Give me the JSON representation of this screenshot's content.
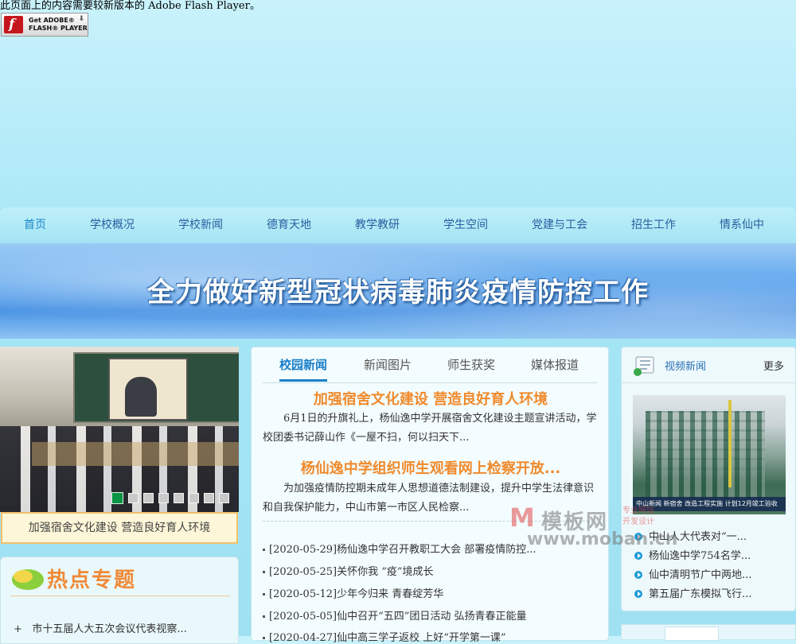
{
  "flash": {
    "notice": "此页面上的内容需要较新版本的 Adobe Flash Player。",
    "badge_line1": "Get ADOBE®",
    "badge_line2": "FLASH® PLAYER"
  },
  "nav": {
    "items": [
      "首页",
      "学校概况",
      "学校新闻",
      "德育天地",
      "教学教研",
      "学生空间",
      "党建与工会",
      "招生工作",
      "情系仙中"
    ],
    "active_index": 0
  },
  "banner": {
    "title": "全力做好新型冠状病毒肺炎疫情防控工作"
  },
  "slider": {
    "caption": "加强宿舍文化建设 营造良好育人环境",
    "dot_count": 8,
    "active_dot": 0
  },
  "hot_topics": {
    "title": "热点专题",
    "items": [
      {
        "prefix": "+",
        "text": "市十五届人大五次会议代表视察..."
      }
    ]
  },
  "news": {
    "tabs": [
      "校园新闻",
      "新闻图片",
      "师生获奖",
      "媒体报道"
    ],
    "active_tab": 0,
    "features": [
      {
        "title": "加强宿舍文化建设 营造良好育人环境",
        "summary": "6月1日的升旗礼上，杨仙逸中学开展宿舍文化建设主题宣讲活动，学校团委书记薛山作《一屋不扫，何以扫天下..."
      },
      {
        "title": "杨仙逸中学组织师生观看网上检察开放...",
        "summary": "为加强疫情防控期未成年人思想道德法制建设，提升中学生法律意识和自我保护能力，中山市第一市区人民检察..."
      }
    ],
    "list": [
      "[2020-05-29]杨仙逸中学召开教职工大会 部署疫情防控...",
      "[2020-05-25]关怀你我 “疫”境成长",
      "[2020-05-12]少年今归来 青春绽芳华",
      "[2020-05-05]仙中召开“五四”团日活动 弘扬青春正能量",
      "[2020-04-27]仙中高三学子返校 上好“开学第一课”"
    ]
  },
  "video": {
    "title": "视频新闻",
    "more": "更多",
    "thumb_caption": "中山新闻   新宿舍 改造工程实施 计划12月竣工验收",
    "items": [
      "中山人大代表对“一...",
      "杨仙逸中学754名学...",
      "仙中清明节广中两地...",
      "第五届广东模拟飞行..."
    ]
  },
  "watermark": {
    "logo": "M",
    "name": "模板网",
    "sub1": "专业网站",
    "sub2": "开发设计",
    "url": "www.moban.cn"
  },
  "colors": {
    "accent_orange": "#f08a2c",
    "link_blue": "#1a7fc9",
    "active_dot": "#0b9444"
  }
}
